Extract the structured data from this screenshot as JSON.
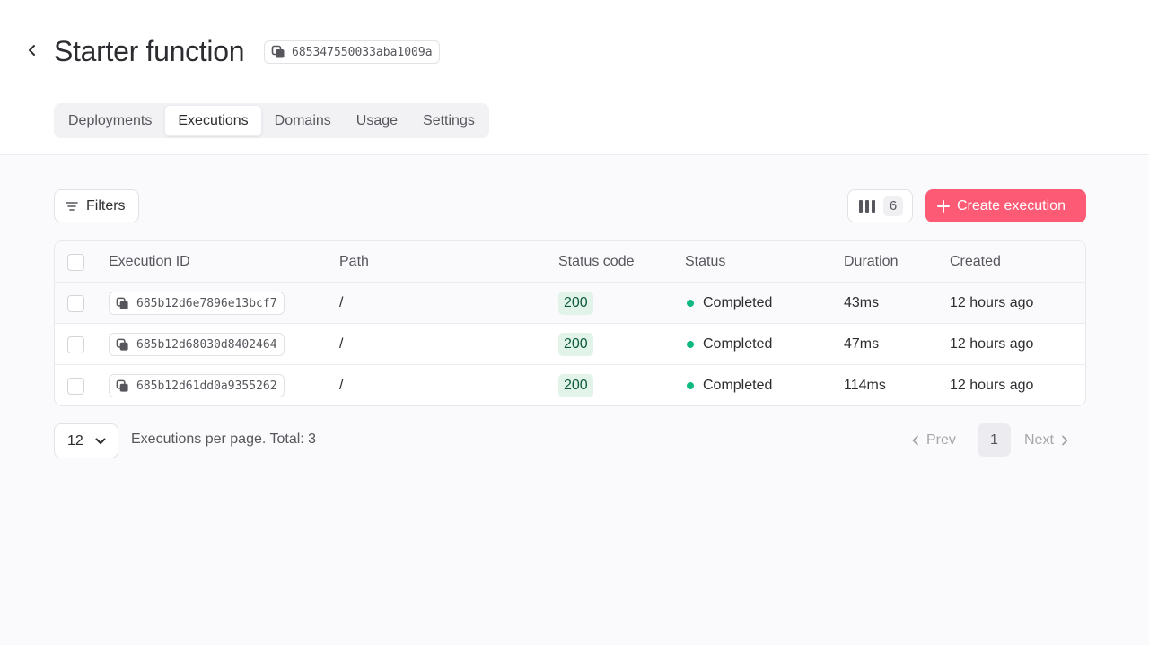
{
  "header": {
    "title": "Starter function",
    "function_id": "685347550033aba1009a",
    "tabs": [
      {
        "label": "Deployments",
        "active": false
      },
      {
        "label": "Executions",
        "active": true
      },
      {
        "label": "Domains",
        "active": false
      },
      {
        "label": "Usage",
        "active": false
      },
      {
        "label": "Settings",
        "active": false
      }
    ]
  },
  "toolbar": {
    "filters_label": "Filters",
    "columns_count": "6",
    "create_label": "Create execution"
  },
  "table": {
    "columns": [
      "Execution ID",
      "Path",
      "Status code",
      "Status",
      "Duration",
      "Created"
    ],
    "rows": [
      {
        "id": "685b12d6e7896e13bcf7",
        "path": "/",
        "status_code": "200",
        "status": "Completed",
        "duration": "43ms",
        "created": "12 hours ago"
      },
      {
        "id": "685b12d68030d8402464",
        "path": "/",
        "status_code": "200",
        "status": "Completed",
        "duration": "47ms",
        "created": "12 hours ago"
      },
      {
        "id": "685b12d61dd0a9355262",
        "path": "/",
        "status_code": "200",
        "status": "Completed",
        "duration": "114ms",
        "created": "12 hours ago"
      }
    ]
  },
  "pagination": {
    "per_page": "12",
    "per_page_text": "Executions per page. Total: 3",
    "prev_label": "Prev",
    "current_page": "1",
    "next_label": "Next"
  },
  "colors": {
    "accent": "#fd5b75",
    "status_completed": "#10b981",
    "code_badge_bg": "#e2f4ea"
  }
}
